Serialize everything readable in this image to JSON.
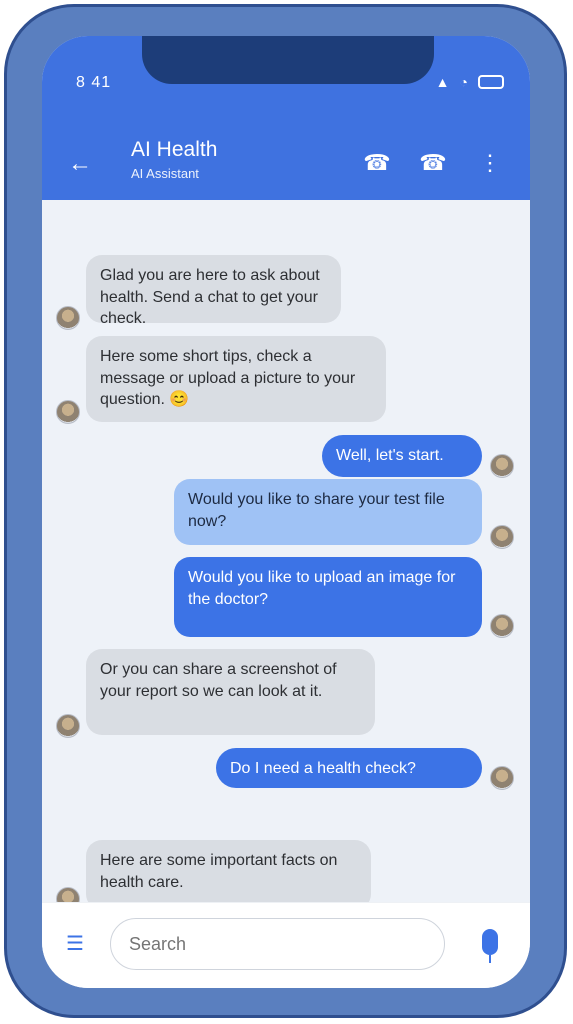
{
  "status": {
    "time": "8 41"
  },
  "header": {
    "title": "AI Health",
    "subtitle": "AI Assistant"
  },
  "messages": [
    {
      "side": "in",
      "text": "Glad you are here to ask about health. Send a chat to get your check."
    },
    {
      "side": "in",
      "text": "Here some short tips, check a message or upload a picture to your question.",
      "emoji": "😊"
    },
    {
      "side": "out",
      "text": "Well, let's start."
    },
    {
      "side": "out",
      "style": "light",
      "text": "Would you like to share your test file now?"
    },
    {
      "side": "out",
      "text": "Would you like to upload an image for the doctor?"
    },
    {
      "side": "in",
      "text": "Or you can share a screenshot of your report so we can look at it."
    },
    {
      "side": "out",
      "text": "Do I need a health check?"
    },
    {
      "side": "in",
      "text": "Here are some important facts on health care."
    }
  ],
  "composer": {
    "placeholder": "Search"
  }
}
